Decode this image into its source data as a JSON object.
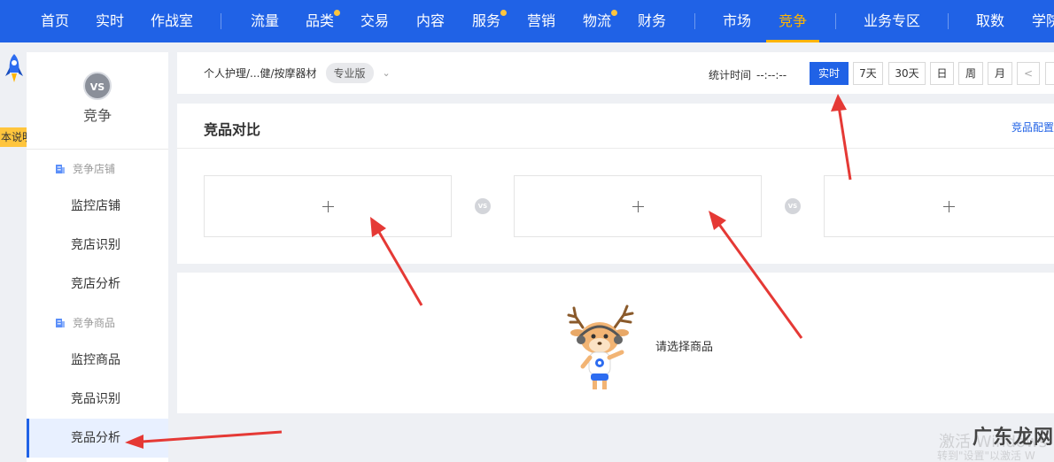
{
  "topnav": {
    "items": [
      {
        "label": "首页",
        "dot": false,
        "active": false
      },
      {
        "label": "实时",
        "dot": false,
        "active": false
      },
      {
        "label": "作战室",
        "dot": false,
        "active": false
      },
      {
        "label": "流量",
        "dot": false,
        "active": false
      },
      {
        "label": "品类",
        "dot": true,
        "active": false
      },
      {
        "label": "交易",
        "dot": false,
        "active": false
      },
      {
        "label": "内容",
        "dot": false,
        "active": false
      },
      {
        "label": "服务",
        "dot": true,
        "active": false
      },
      {
        "label": "营销",
        "dot": false,
        "active": false
      },
      {
        "label": "物流",
        "dot": true,
        "active": false
      },
      {
        "label": "财务",
        "dot": false,
        "active": false
      },
      {
        "label": "市场",
        "dot": false,
        "active": false
      },
      {
        "label": "竞争",
        "dot": false,
        "active": true
      },
      {
        "label": "业务专区",
        "dot": false,
        "active": false
      },
      {
        "label": "取数",
        "dot": false,
        "active": false
      },
      {
        "label": "学院",
        "dot": false,
        "active": false
      }
    ]
  },
  "rail": {
    "tag": "本说明"
  },
  "sidebar": {
    "badge": "VS",
    "title": "竞争",
    "group1": "竞争店铺",
    "group1_items": [
      "监控店铺",
      "竞店识别",
      "竞店分析"
    ],
    "group2": "竞争商品",
    "group2_items": [
      "监控商品",
      "竞品识别",
      "竞品分析"
    ]
  },
  "filter": {
    "category": "个人护理/...健/按摩器材",
    "edition": "专业版",
    "stat_label": "统计时间",
    "stat_value": "--:--:--",
    "ranges": [
      "实时",
      "7天",
      "30天",
      "日",
      "周",
      "月"
    ],
    "prev": "<"
  },
  "compare": {
    "title": "竞品对比",
    "config_link": "竞品配置",
    "vs": "VS"
  },
  "empty": {
    "text": "请选择商品"
  },
  "watermark": {
    "line1": "激活 Windows",
    "line2": "转到\"设置\"以激活 W",
    "logo": "广东龙网"
  },
  "colors": {
    "nav_bg": "#2062e6",
    "accent": "#ffb400",
    "arrow": "#e53935"
  }
}
